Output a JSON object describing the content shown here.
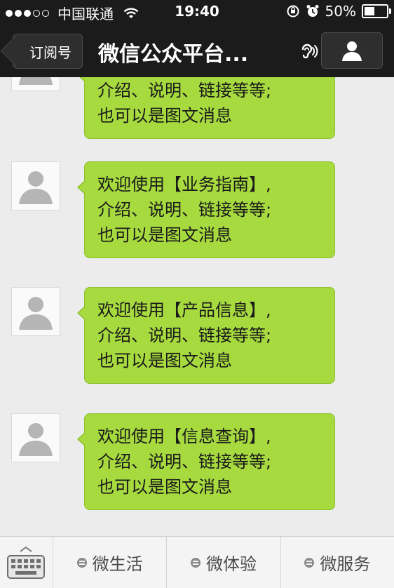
{
  "status_bar": {
    "carrier": "中国联通",
    "time": "19:40",
    "battery": "50%",
    "battery_level": 0.5,
    "signal_bars": 3,
    "signal_total": 5
  },
  "nav": {
    "back_label": "订阅号",
    "title": "微信公众平台...",
    "icons": [
      "ear-icon",
      "person-icon"
    ]
  },
  "messages": [
    {
      "lines": [
        "介绍、说明、链接等等;",
        "也可以是图文消息"
      ]
    },
    {
      "lines": [
        "欢迎使用【业务指南】,",
        "介绍、说明、链接等等;",
        "也可以是图文消息"
      ]
    },
    {
      "lines": [
        "欢迎使用【产品信息】,",
        "介绍、说明、链接等等;",
        "也可以是图文消息"
      ]
    },
    {
      "lines": [
        "欢迎使用【信息查询】,",
        "介绍、说明、链接等等;",
        "也可以是图文消息"
      ]
    }
  ],
  "bottom_menu": {
    "keyboard_icon": "keyboard-icon",
    "items": [
      {
        "label": "微生活",
        "icon": "menu-icon"
      },
      {
        "label": "微体验",
        "icon": "menu-icon"
      },
      {
        "label": "微服务",
        "icon": "menu-icon"
      }
    ]
  },
  "colors": {
    "bubble": "#a6da3f",
    "bar": "#1b1b1b",
    "chat_bg": "#ececec"
  }
}
